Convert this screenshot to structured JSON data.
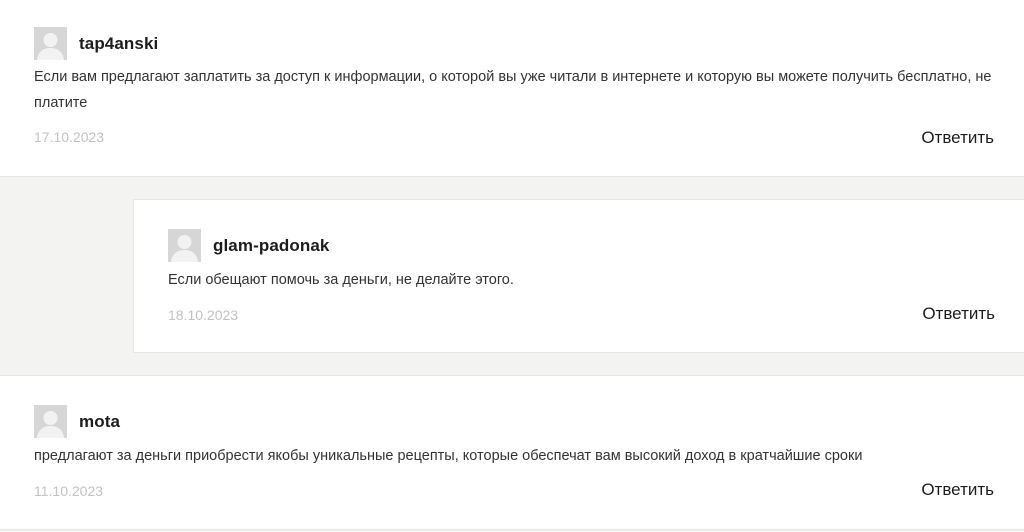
{
  "comments": [
    {
      "author": "tap4anski",
      "text": "Если вам предлагают заплатить за доступ к информации, о которой вы уже читали в интернете и которую вы можете получить бесплатно, не платите",
      "date": "17.10.2023",
      "reply_label": "Ответить",
      "avatar_icon": "user-silhouette-icon"
    },
    {
      "author": "glam-padonak",
      "text": "Если обещают помочь за деньги, не делайте этого.",
      "date": "18.10.2023",
      "reply_label": "Ответить",
      "avatar_icon": "user-silhouette-icon"
    },
    {
      "author": "mota",
      "text": "предлагают за деньги приобрести якобы уникальные рецепты, которые обеспечат вам высокий доход в кратчайшие сроки",
      "date": "11.10.2023",
      "reply_label": "Ответить",
      "avatar_icon": "user-silhouette-icon"
    }
  ],
  "colors": {
    "background": "#f3f3f1",
    "card": "#ffffff",
    "date": "#c2c2c2",
    "avatar": "#d6d6d6"
  }
}
